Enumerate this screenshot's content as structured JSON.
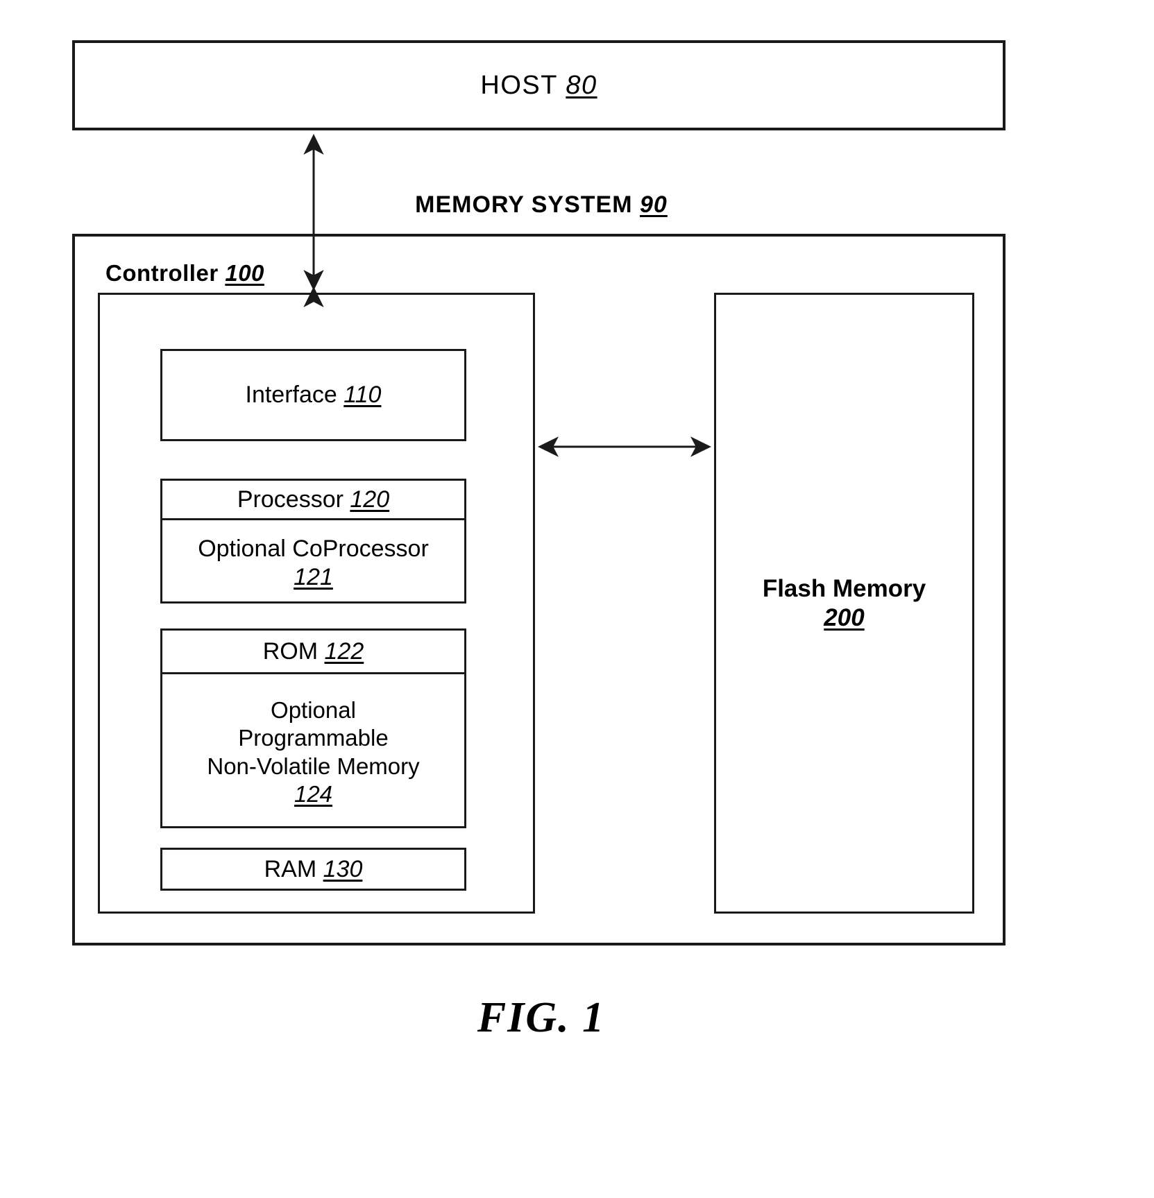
{
  "figure": {
    "caption": "FIG. 1"
  },
  "host": {
    "label": "HOST",
    "ref": "80"
  },
  "memory_system": {
    "label": "MEMORY SYSTEM",
    "ref": "90"
  },
  "controller": {
    "label": "Controller",
    "ref": "100",
    "blocks": {
      "interface": {
        "label": "Interface",
        "ref": "110"
      },
      "processor": {
        "label": "Processor",
        "ref": "120"
      },
      "coprocessor": {
        "label": "Optional CoProcessor",
        "ref": "121"
      },
      "rom": {
        "label": "ROM",
        "ref": "122"
      },
      "nonvolatile_memory": {
        "line1": "Optional",
        "line2": "Programmable",
        "line3": "Non-Volatile Memory",
        "ref": "124"
      },
      "ram": {
        "label": "RAM",
        "ref": "130"
      }
    }
  },
  "flash_memory": {
    "label": "Flash Memory",
    "ref": "200"
  },
  "connections": [
    {
      "name": "host-to-controller",
      "from": "Controller 100",
      "to": "HOST 80",
      "style": "double-headed-vertical-arrow"
    },
    {
      "name": "controller-to-flash",
      "from": "Controller 100",
      "to": "Flash Memory 200",
      "style": "double-headed-horizontal-arrow"
    }
  ],
  "colors": {
    "line": "#1a1a1a",
    "background": "#ffffff",
    "text": "#000000"
  }
}
